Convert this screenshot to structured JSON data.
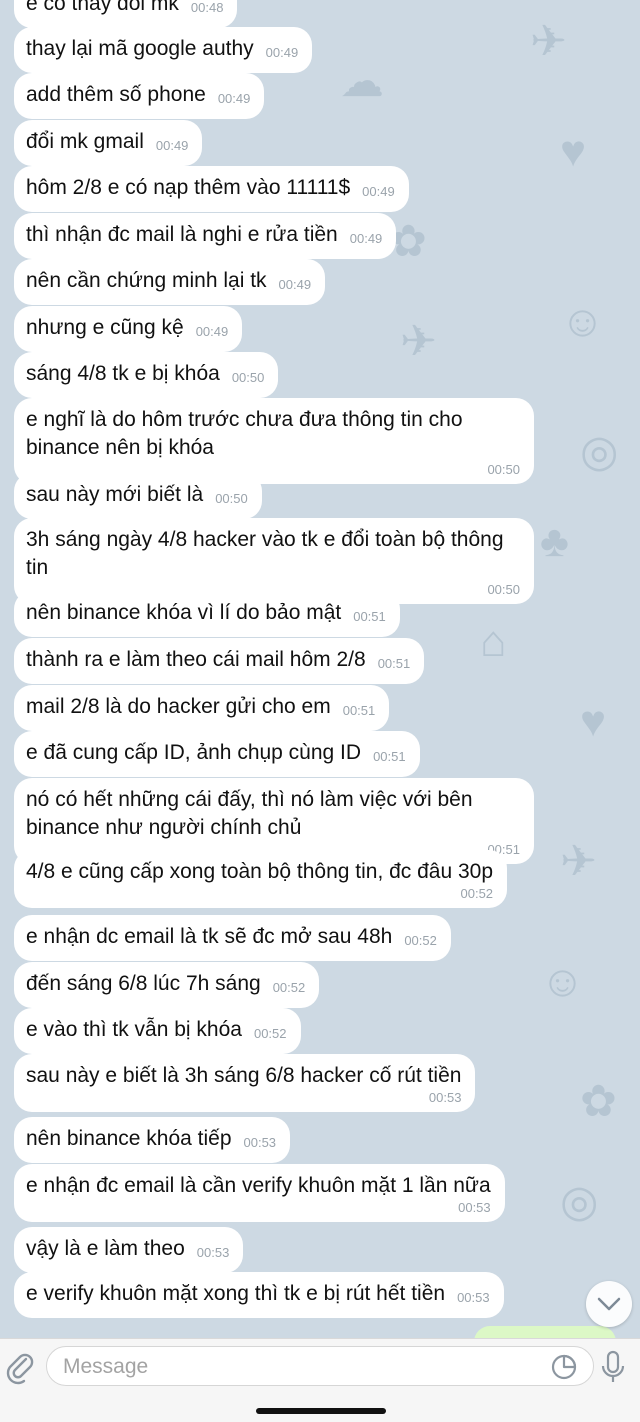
{
  "messages": [
    {
      "text": "e có thay đổi mk",
      "time": "00:48"
    },
    {
      "text": "thay lại mã google authy",
      "time": "00:49"
    },
    {
      "text": "add thêm số phone",
      "time": "00:49"
    },
    {
      "text": "đổi mk gmail",
      "time": "00:49"
    },
    {
      "text": "hôm 2/8 e có nạp thêm vào 11111$",
      "time": "00:49"
    },
    {
      "text": "thì nhận đc mail là nghi e rửa tiền",
      "time": "00:49"
    },
    {
      "text": "nên cần chứng minh lại tk",
      "time": "00:49"
    },
    {
      "text": "nhưng e cũng kệ",
      "time": "00:49"
    },
    {
      "text": "sáng 4/8 tk e bị khóa",
      "time": "00:50"
    },
    {
      "text": "e nghĩ là do hôm trước chưa đưa thông tin cho binance nên bị khóa",
      "time": "00:50"
    },
    {
      "text": "sau này mới biết là",
      "time": "00:50"
    },
    {
      "text": "3h sáng ngày 4/8 hacker vào tk e đổi toàn bộ thông tin",
      "time": "00:50"
    },
    {
      "text": "nên binance khóa vì lí do bảo mật",
      "time": "00:51"
    },
    {
      "text": "thành ra e làm theo cái mail hôm 2/8",
      "time": "00:51"
    },
    {
      "text": "mail 2/8 là do hacker gửi cho em",
      "time": "00:51"
    },
    {
      "text": "e đã cung cấp ID, ảnh chụp cùng ID",
      "time": "00:51"
    },
    {
      "text": "nó có hết những cái đấy, thì nó làm việc với bên binance như người chính chủ",
      "time": "00:51"
    },
    {
      "text": "4/8 e cũng cấp xong toàn bộ thông tin, đc đâu 30p",
      "time": "00:52"
    },
    {
      "text": "e nhận dc email là tk sẽ đc mở sau 48h",
      "time": "00:52"
    },
    {
      "text": "đến sáng 6/8 lúc 7h sáng",
      "time": "00:52"
    },
    {
      "text": "e vào thì tk vẫn bị khóa",
      "time": "00:52"
    },
    {
      "text": "sau này e biết là 3h sáng 6/8 hacker cố rút tiền",
      "time": "00:53"
    },
    {
      "text": "nên binance khóa tiếp",
      "time": "00:53"
    },
    {
      "text": "e nhận đc email là cần verify khuôn mặt 1 lần nữa",
      "time": "00:53"
    },
    {
      "text": "vậy là e làm theo",
      "time": "00:53"
    },
    {
      "text": "e verify khuôn mặt xong thì tk e bị rút hết tiền",
      "time": "00:53"
    }
  ],
  "composer": {
    "placeholder": "Message"
  },
  "icons": {
    "attach": "paperclip-icon",
    "sticker": "sticker-icon",
    "mic": "microphone-icon",
    "scroll": "chevron-down-icon"
  },
  "colors": {
    "bubble": "#ffffff",
    "background": "#cdd9e3",
    "outgoing": "#dcf8c6",
    "time": "#9aa3ab"
  }
}
